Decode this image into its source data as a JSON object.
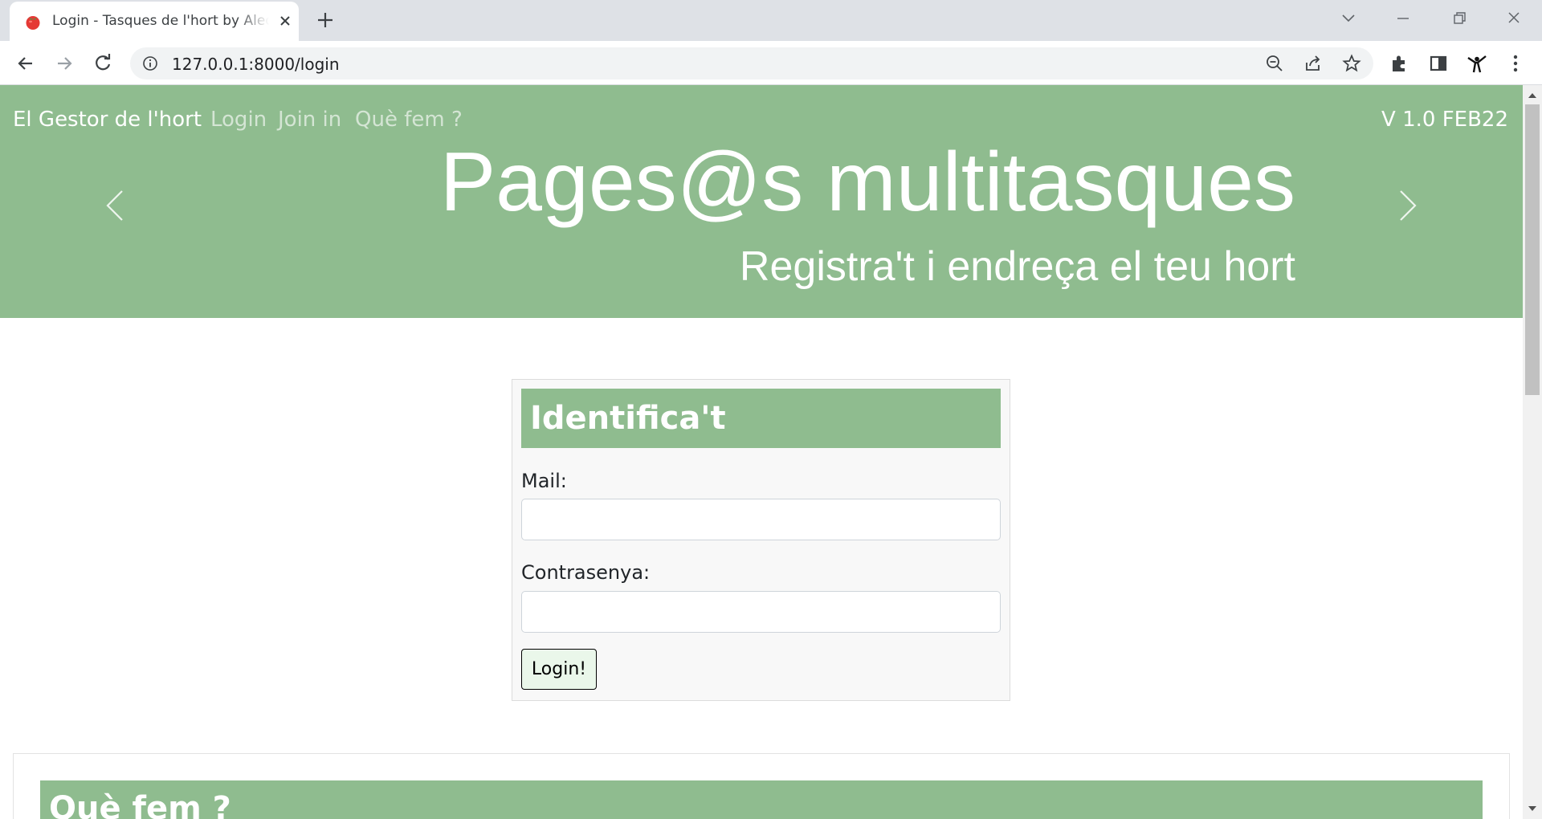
{
  "browser": {
    "tab_title": "Login - Tasques de l'hort by Aleoc",
    "url": "127.0.0.1:8000/login",
    "favicon": "tomato-icon"
  },
  "nav": {
    "brand": "El Gestor de l'hort",
    "links": [
      "Login",
      "Join in",
      "Què fem ?"
    ],
    "version": "V 1.0 FEB22"
  },
  "hero": {
    "title": "Pages@s multitasques",
    "subtitle": "Registra't i endreça el teu hort"
  },
  "login": {
    "heading": "Identifica't",
    "mail_label": "Mail:",
    "mail_value": "",
    "password_label": "Contrasenya:",
    "password_value": "",
    "button": "Login!"
  },
  "about": {
    "heading": "Què fem ?"
  },
  "colors": {
    "accent": "#8fbc8f",
    "button_bg": "#eaf7ea"
  }
}
